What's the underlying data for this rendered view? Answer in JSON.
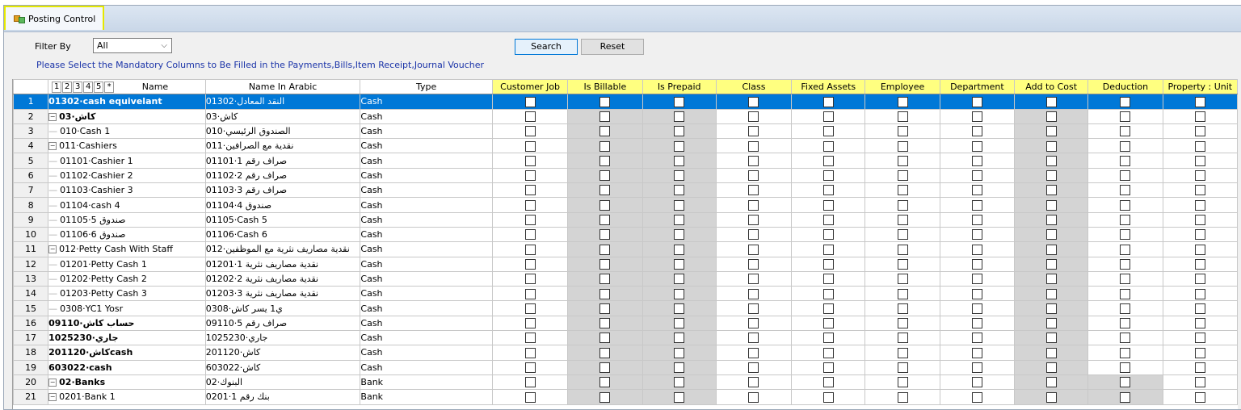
{
  "tab": {
    "label": "Posting Control"
  },
  "filter": {
    "label": "Filter By",
    "value": "All"
  },
  "buttons": {
    "search": "Search",
    "reset": "Reset"
  },
  "hint": "Please Select the Mandatory Columns to Be Filled in the Payments,Bills,Item Receipt,Journal Voucher",
  "grid": {
    "level_buttons": [
      "1",
      "2",
      "3",
      "4",
      "5",
      "*"
    ],
    "columns": {
      "name": "Name",
      "arabic": "Name In Arabic",
      "type": "Type",
      "checks": [
        "Customer Job",
        "Is Billable",
        "Is Prepaid",
        "Class",
        "Fixed Assets",
        "Employee",
        "Department",
        "Add to Cost",
        "Deduction",
        "Property : Unit"
      ]
    },
    "rows": [
      {
        "n": "1",
        "name": "01302·cash equivelant",
        "ar": "01302·النقد المعادل",
        "type": "Cash",
        "lvl": 0,
        "bold": true,
        "exp": "",
        "sel": true
      },
      {
        "n": "2",
        "name": "كاش·03",
        "ar": "كاش·03",
        "type": "Cash",
        "lvl": 0,
        "bold": true,
        "exp": "⊟"
      },
      {
        "n": "3",
        "name": "010·Cash 1",
        "ar": "الصندوق الرئيسي·010",
        "type": "Cash",
        "lvl": 1,
        "bold": false,
        "exp": ""
      },
      {
        "n": "4",
        "name": "011·Cashiers",
        "ar": "نقدية مع الصرافين·011",
        "type": "Cash",
        "lvl": 1,
        "bold": false,
        "exp": "⊟"
      },
      {
        "n": "5",
        "name": "01101·Cashier 1",
        "ar": "صراف رقم 1·01101",
        "type": "Cash",
        "lvl": 2,
        "bold": false,
        "exp": ""
      },
      {
        "n": "6",
        "name": "01102·Cashier 2",
        "ar": "صراف رقم 2·01102",
        "type": "Cash",
        "lvl": 2,
        "bold": false,
        "exp": ""
      },
      {
        "n": "7",
        "name": "01103·Cashier 3",
        "ar": "صراف رقم 3·01103",
        "type": "Cash",
        "lvl": 2,
        "bold": false,
        "exp": ""
      },
      {
        "n": "8",
        "name": "01104·cash 4",
        "ar": "صندوق 4·01104",
        "type": "Cash",
        "lvl": 2,
        "bold": false,
        "exp": ""
      },
      {
        "n": "9",
        "name": "01105·صندوق 5",
        "ar": "01105·Cash 5",
        "type": "Cash",
        "lvl": 2,
        "bold": false,
        "exp": ""
      },
      {
        "n": "10",
        "name": "01106·صندوق 6",
        "ar": "01106·Cash 6",
        "type": "Cash",
        "lvl": 2,
        "bold": false,
        "exp": ""
      },
      {
        "n": "11",
        "name": "012·Petty Cash With Staff",
        "ar": "نقدية مصاريف نثرية مع الموظفين·012",
        "type": "Cash",
        "lvl": 1,
        "bold": false,
        "exp": "⊟"
      },
      {
        "n": "12",
        "name": "01201·Petty Cash  1",
        "ar": "نقدية مصاريف نثرية 1·01201",
        "type": "Cash",
        "lvl": 2,
        "bold": false,
        "exp": ""
      },
      {
        "n": "13",
        "name": "01202·Petty Cash  2",
        "ar": "نقدية مصاريف نثرية 2·01202",
        "type": "Cash",
        "lvl": 2,
        "bold": false,
        "exp": ""
      },
      {
        "n": "14",
        "name": "01203·Petty Cash  3",
        "ar": "نقدية مصاريف نثرية 3·01203",
        "type": "Cash",
        "lvl": 2,
        "bold": false,
        "exp": ""
      },
      {
        "n": "15",
        "name": "0308·YC1 Yosr",
        "ar": "ي1 يسر كاش·0308",
        "type": "Cash",
        "lvl": 1,
        "bold": false,
        "exp": ""
      },
      {
        "n": "16",
        "name": "حساب كاش·09110",
        "ar": "صراف رقم 5·09110",
        "type": "Cash",
        "lvl": 0,
        "bold": true,
        "exp": ""
      },
      {
        "n": "17",
        "name": "جاري·1025230",
        "ar": "جاري·1025230",
        "type": "Cash",
        "lvl": 0,
        "bold": true,
        "exp": ""
      },
      {
        "n": "18",
        "name": "كاش·201120cash",
        "ar": "كاش·201120",
        "type": "Cash",
        "lvl": 0,
        "bold": true,
        "exp": ""
      },
      {
        "n": "19",
        "name": "603022·cash",
        "ar": "كاش·603022",
        "type": "Cash",
        "lvl": 0,
        "bold": true,
        "exp": ""
      },
      {
        "n": "20",
        "name": "02·Banks",
        "ar": "البنوك·02",
        "type": "Bank",
        "lvl": 0,
        "bold": true,
        "exp": "⊟"
      },
      {
        "n": "21",
        "name": "0201·Bank 1",
        "ar": "بنك رقم 1·0201",
        "type": "Bank",
        "lvl": 1,
        "bold": false,
        "exp": "⊟"
      }
    ]
  }
}
